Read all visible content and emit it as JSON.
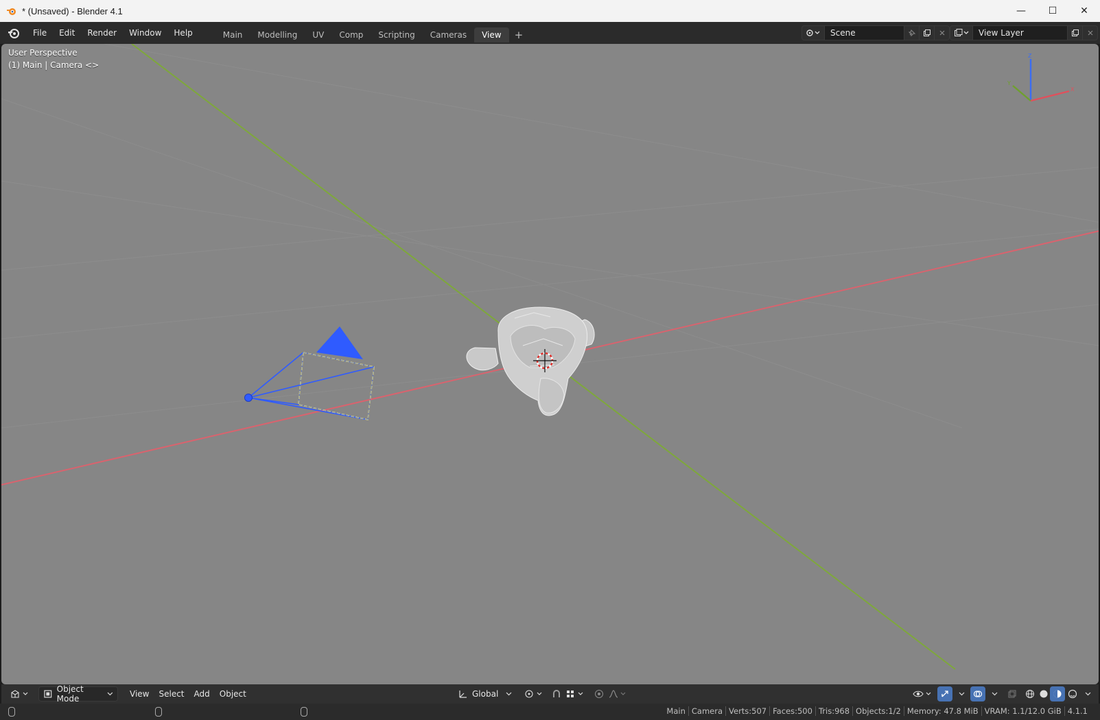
{
  "window": {
    "title": "* (Unsaved) - Blender 4.1",
    "minimize": "—",
    "maximize": "☐",
    "close": "✕"
  },
  "menu": {
    "items": [
      "File",
      "Edit",
      "Render",
      "Window",
      "Help"
    ]
  },
  "workspaces": {
    "tabs": [
      "Main",
      "Modelling",
      "UV",
      "Comp",
      "Scripting",
      "Cameras",
      "View"
    ],
    "active": "View",
    "add_label": "+"
  },
  "scene_selector": {
    "value": "Scene"
  },
  "view_layer_selector": {
    "value": "View Layer"
  },
  "viewport": {
    "perspective_label": "User Perspective",
    "context_label": "(1) Main | Camera <>",
    "gizmo": {
      "z": "Z",
      "x": "X",
      "y": "Y"
    },
    "colors": {
      "background": "#868686",
      "x_axis": "#d9636e",
      "y_axis": "#7ea83a",
      "camera": "#2f5bff",
      "camera_selected": "#f0e26a"
    }
  },
  "header": {
    "mode": "Object Mode",
    "menus": [
      "View",
      "Select",
      "Add",
      "Object"
    ],
    "orientation": "Global"
  },
  "status": {
    "stats": [
      "Main",
      "Camera",
      "Verts:507",
      "Faces:500",
      "Tris:968",
      "Objects:1/2",
      "Memory: 47.8 MiB",
      "VRAM: 1.1/12.0 GiB",
      "4.1.1"
    ]
  }
}
